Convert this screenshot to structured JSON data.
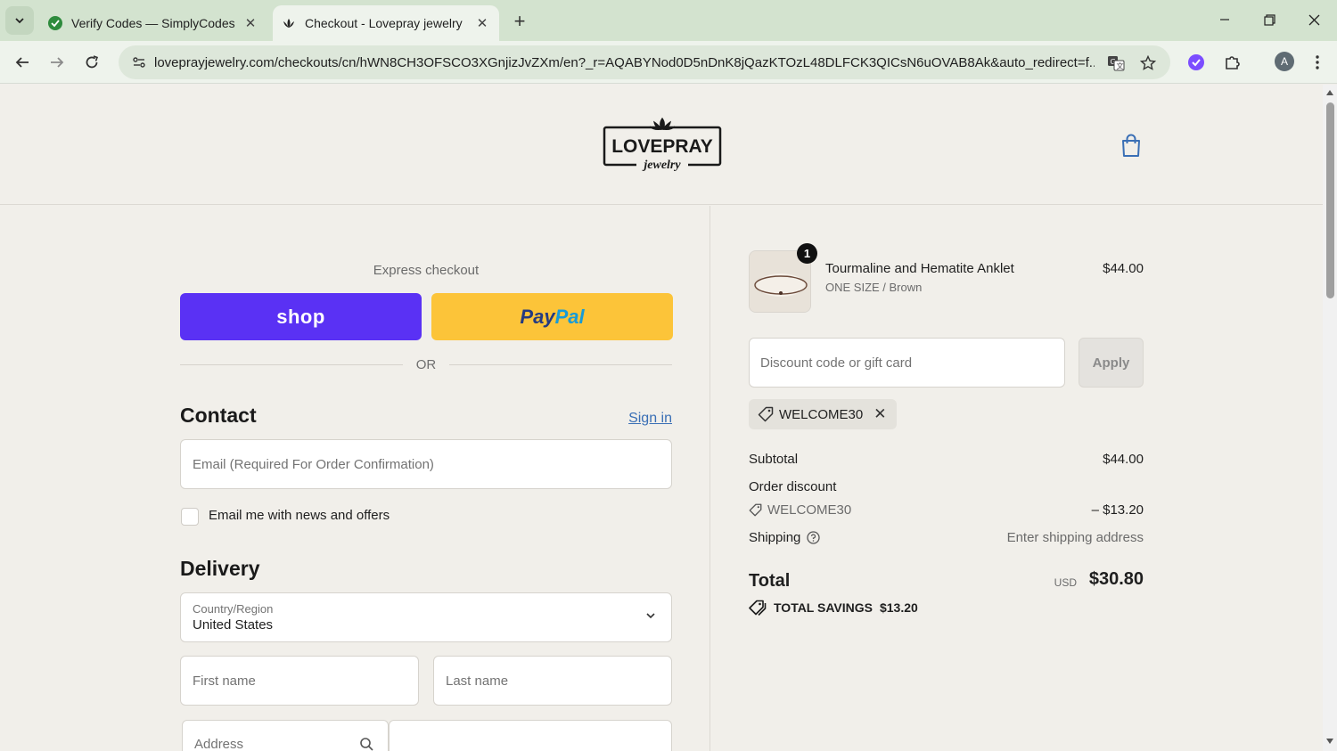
{
  "browser": {
    "tabs": [
      {
        "title": "Verify Codes — SimplyCodes",
        "active": false
      },
      {
        "title": "Checkout - Lovepray jewelry",
        "active": true
      }
    ],
    "url": "loveprayjewelry.com/checkouts/cn/hWN8CH3OFSCO3XGnjizJvZXm/en?_r=AQABYNod0D5nDnK8jQazKTOzL48DLFCK3QICsN6uOVAB8Ak&auto_redirect=f...",
    "profile_initial": "A"
  },
  "header": {
    "logo_main": "LOVEPRAY",
    "logo_script": "jewelry"
  },
  "express": {
    "label": "Express checkout",
    "shop_label": "shop",
    "paypal_pay": "Pay",
    "paypal_pal": "Pal",
    "or": "OR"
  },
  "contact": {
    "heading": "Contact",
    "signin": "Sign in",
    "email_placeholder": "Email (Required For Order Confirmation)",
    "newsletter_label": "Email me with news and offers"
  },
  "delivery": {
    "heading": "Delivery",
    "country_label": "Country/Region",
    "country_value": "United States",
    "first_name_placeholder": "First name",
    "last_name_placeholder": "Last name",
    "address_placeholder": "Address"
  },
  "summary": {
    "item": {
      "quantity": "1",
      "name": "Tourmaline and Hematite Anklet",
      "variant": "ONE SIZE / Brown",
      "price": "$44.00"
    },
    "discount_placeholder": "Discount code or gift card",
    "apply_label": "Apply",
    "applied_code": "WELCOME30",
    "subtotal_label": "Subtotal",
    "subtotal_value": "$44.00",
    "order_discount_label": "Order discount",
    "discount_code": "WELCOME30",
    "discount_value": "– $13.20",
    "shipping_label": "Shipping",
    "shipping_value": "Enter shipping address",
    "total_label": "Total",
    "total_currency": "USD",
    "total_value": "$30.80",
    "savings_label": "TOTAL SAVINGS",
    "savings_value": "$13.20"
  },
  "colors": {
    "shop_pay": "#5a31f4",
    "paypal": "#fcc439",
    "link": "#3a6fb5"
  }
}
